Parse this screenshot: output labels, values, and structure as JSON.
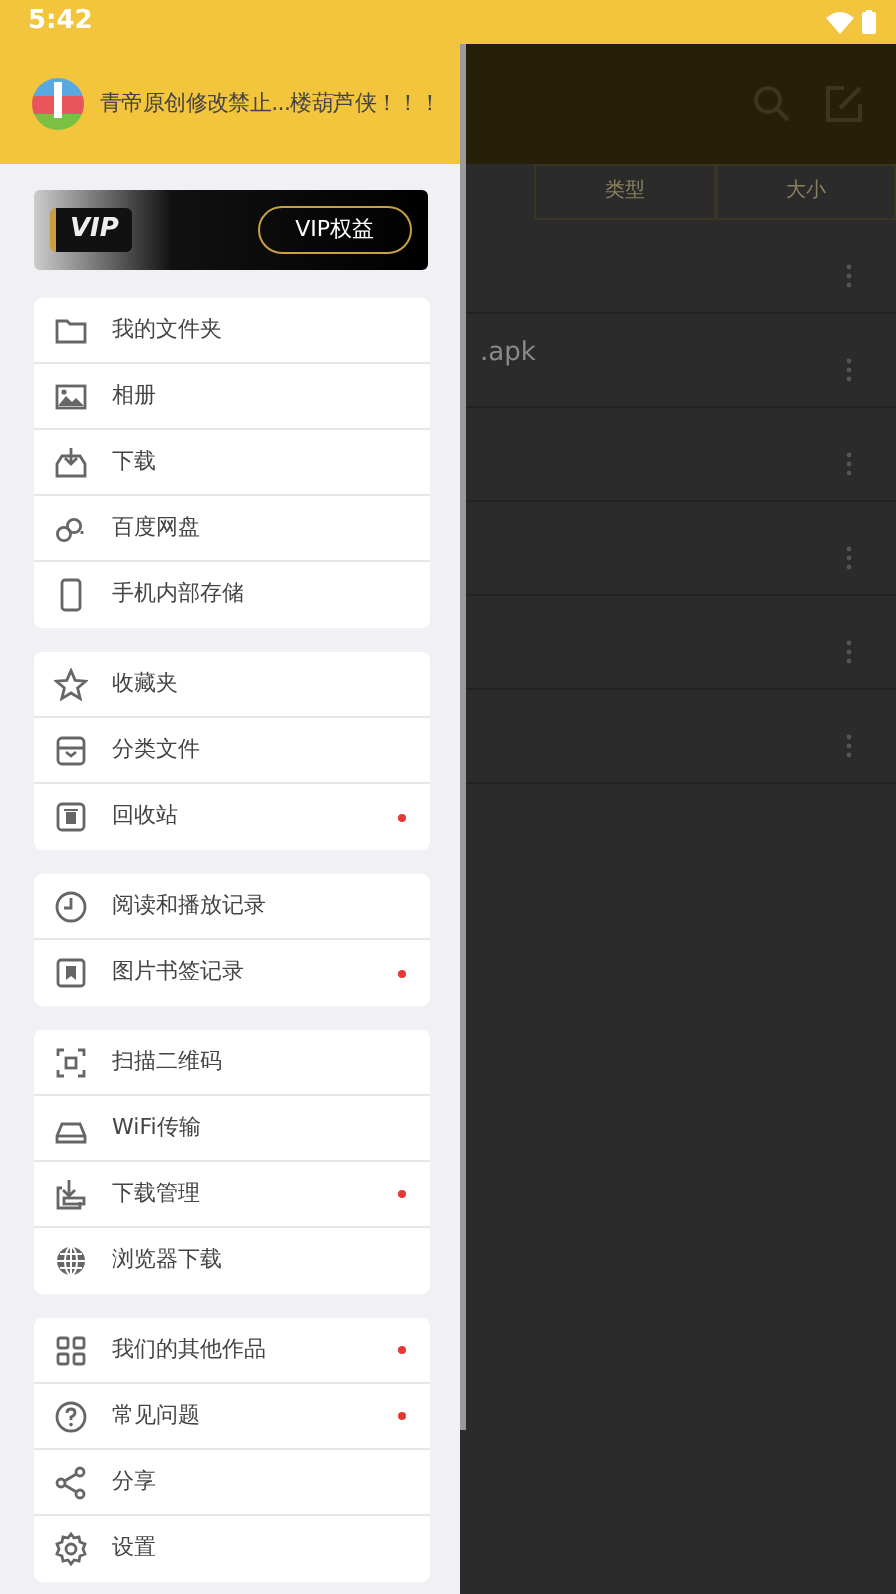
{
  "status_bar": {
    "time": "5:42"
  },
  "drawer": {
    "title": "青帝原创修改禁止...楼葫芦侠！！！",
    "vip": {
      "badge": "VIP",
      "button": "VIP权益"
    },
    "groups": [
      {
        "items": [
          {
            "label": "我的文件夹",
            "kind": "folder",
            "badge": false
          },
          {
            "label": "相册",
            "kind": "image",
            "badge": false
          },
          {
            "label": "下载",
            "kind": "download",
            "badge": false
          },
          {
            "label": "百度网盘",
            "kind": "cloud",
            "badge": false
          },
          {
            "label": "手机内部存储",
            "kind": "phone",
            "badge": false
          }
        ]
      },
      {
        "items": [
          {
            "label": "收藏夹",
            "kind": "star",
            "badge": false
          },
          {
            "label": "分类文件",
            "kind": "box",
            "badge": false
          },
          {
            "label": "回收站",
            "kind": "trash",
            "badge": true
          }
        ]
      },
      {
        "items": [
          {
            "label": "阅读和播放记录",
            "kind": "clock",
            "badge": false
          },
          {
            "label": "图片书签记录",
            "kind": "bookmark",
            "badge": true
          }
        ]
      },
      {
        "items": [
          {
            "label": "扫描二维码",
            "kind": "scan",
            "badge": false
          },
          {
            "label": "WiFi传输",
            "kind": "router",
            "badge": false
          },
          {
            "label": "下载管理",
            "kind": "dlmanage",
            "badge": true
          },
          {
            "label": "浏览器下载",
            "kind": "globe",
            "badge": false
          }
        ]
      },
      {
        "items": [
          {
            "label": "我们的其他作品",
            "kind": "grid",
            "badge": true
          },
          {
            "label": "常见问题",
            "kind": "help",
            "badge": true
          },
          {
            "label": "分享",
            "kind": "share",
            "badge": false
          },
          {
            "label": "设置",
            "kind": "gear",
            "badge": false
          }
        ]
      }
    ]
  },
  "background": {
    "columns": [
      "类型",
      "大小"
    ],
    "rows": [
      {},
      {
        "name": ".apk"
      },
      {},
      {},
      {},
      {}
    ]
  }
}
